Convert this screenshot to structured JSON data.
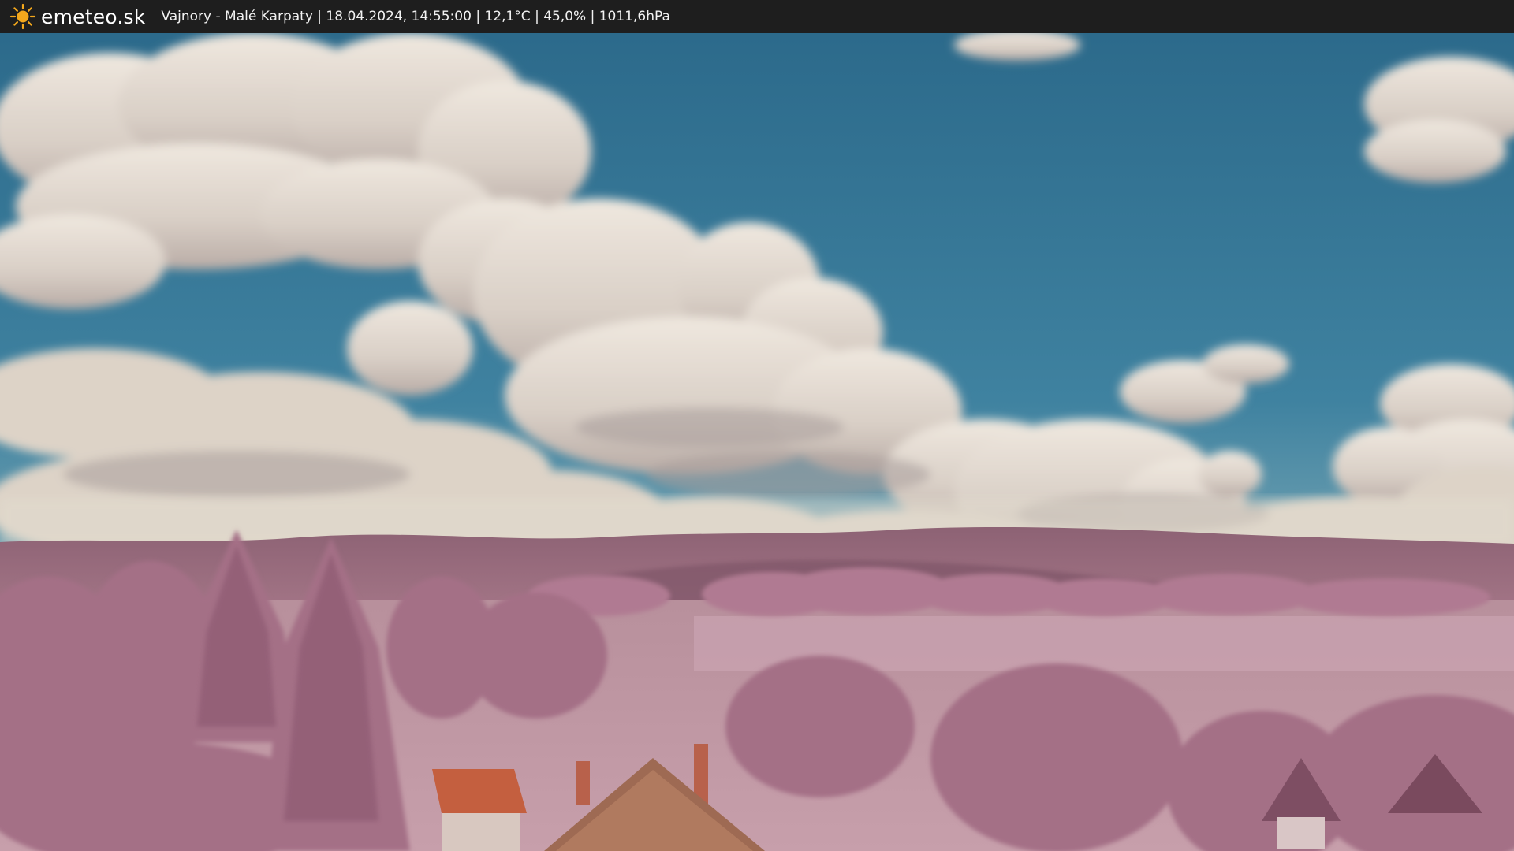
{
  "header": {
    "brand": "emeteo.sk",
    "brand_icon": "sun-icon",
    "caption": "Vajnory - Malé Karpaty | 18.04.2024, 14:55:00 | 12,1°C | 45,0% | 1011,6hPa"
  },
  "colors": {
    "bar": "#1e1e1e",
    "sun": "#f4a81c",
    "sky_top": "#2f6f8f",
    "sky_low": "#6fa3b4",
    "cloud": "#e6ddd2",
    "hills": "#93677a",
    "foliage": "#b7829a",
    "roof": "#b9553a"
  }
}
